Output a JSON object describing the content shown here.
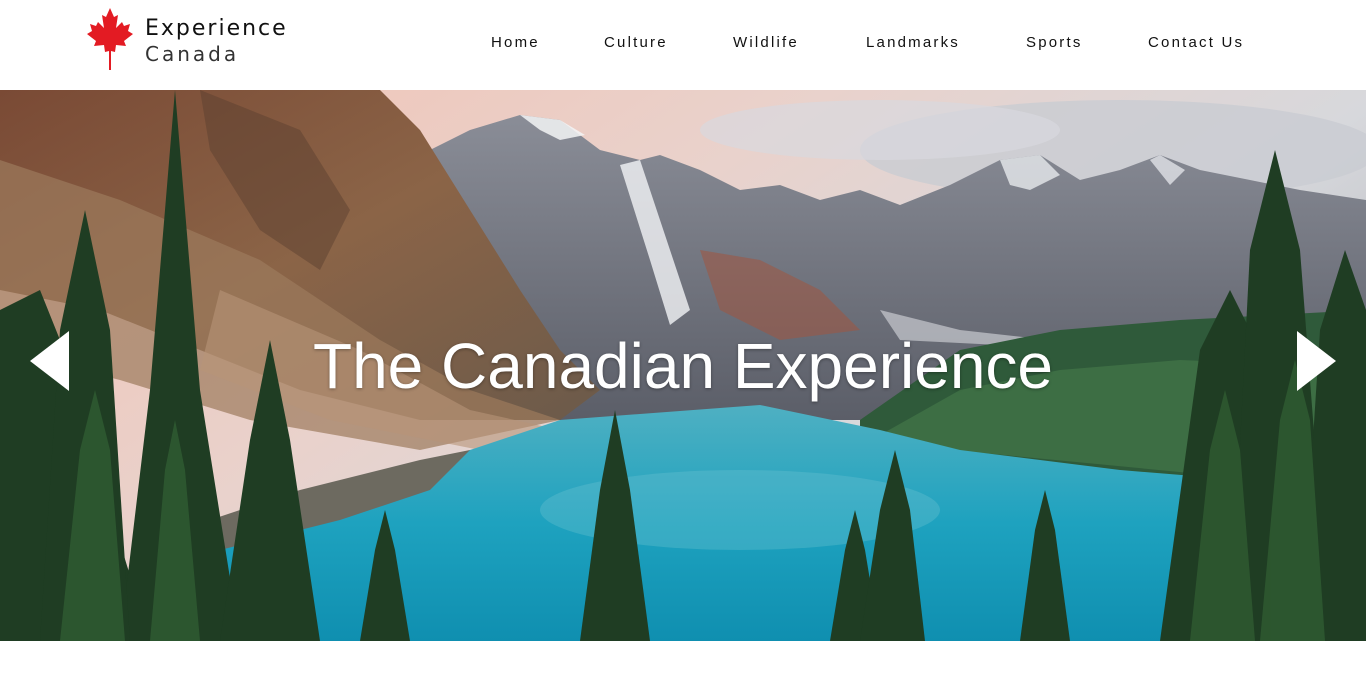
{
  "brand": {
    "line1": "Experience",
    "line2": "Canada",
    "logo_icon": "maple-leaf-icon",
    "accent_color": "#e31b23"
  },
  "nav": {
    "items": [
      {
        "label": "Home"
      },
      {
        "label": "Culture"
      },
      {
        "label": "Wildlife"
      },
      {
        "label": "Landmarks"
      },
      {
        "label": "Sports"
      },
      {
        "label": "Contact Us"
      }
    ]
  },
  "hero": {
    "title": "The Canadian Experience",
    "prev_icon": "arrow-left-icon",
    "next_icon": "arrow-right-icon"
  }
}
